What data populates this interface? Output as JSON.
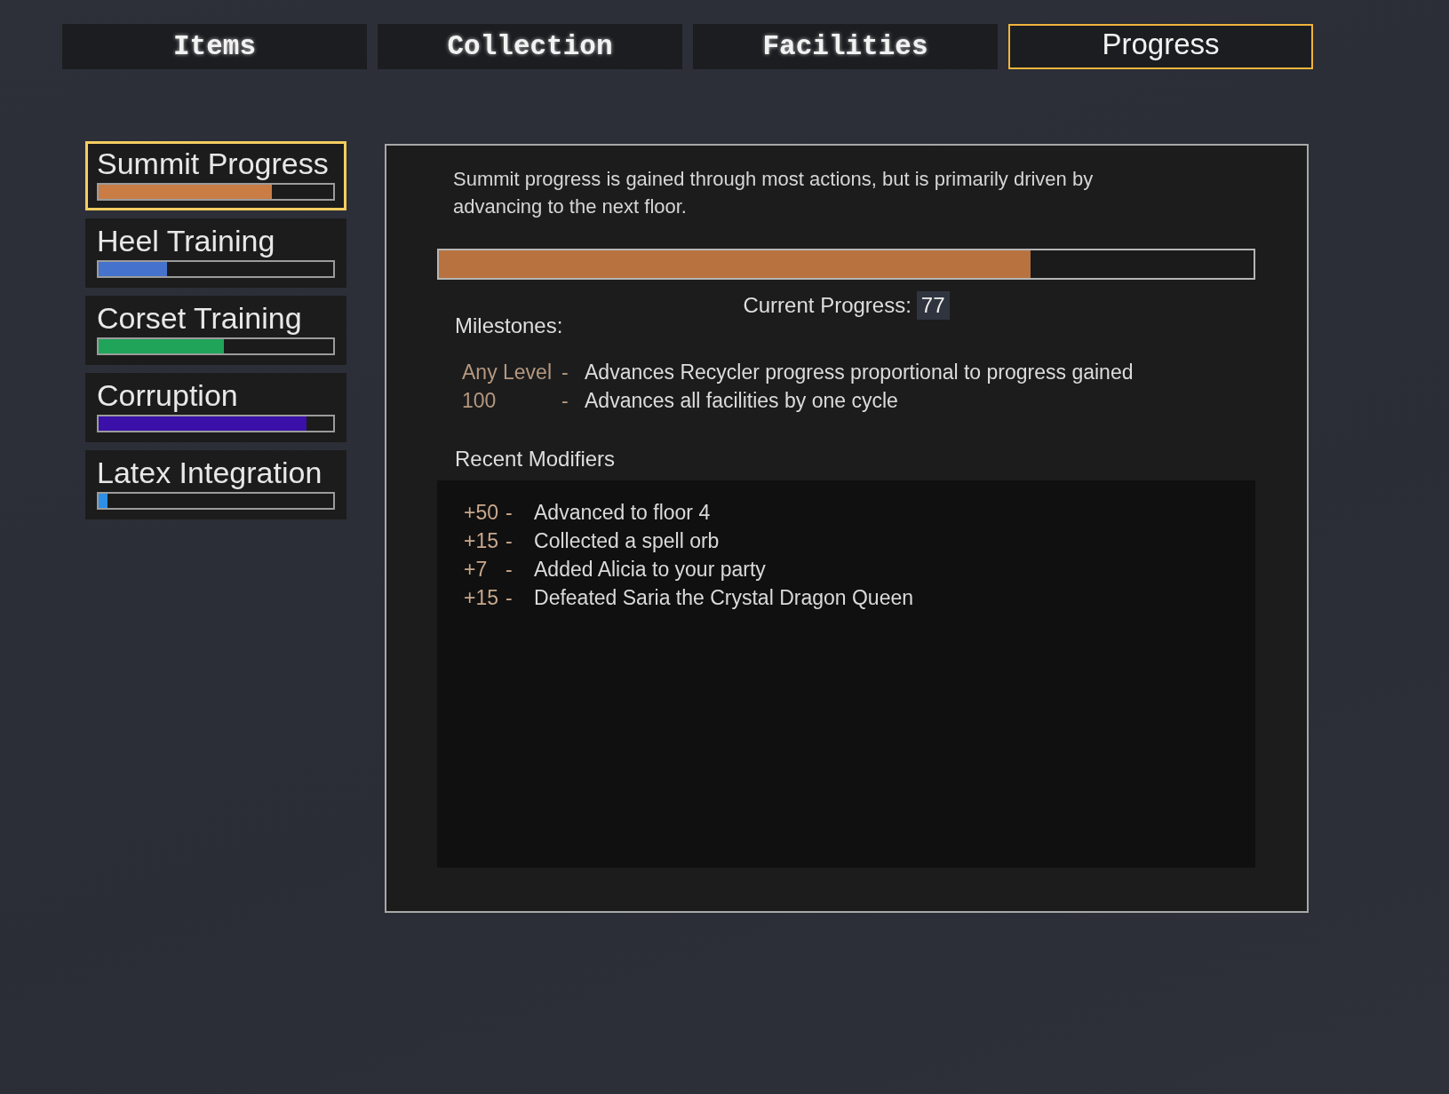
{
  "tabs": [
    {
      "label": "Items",
      "selected": false
    },
    {
      "label": "Collection",
      "selected": false
    },
    {
      "label": "Facilities",
      "selected": false
    },
    {
      "label": "Progress",
      "selected": true
    }
  ],
  "sidebar": {
    "items": [
      {
        "label": "Summit Progress",
        "selected": true,
        "level": 0.74,
        "color": "#c97d45"
      },
      {
        "label": "Heel Training",
        "selected": false,
        "level": 0.29,
        "color": "#4472cc"
      },
      {
        "label": "Corset Training",
        "selected": false,
        "level": 0.535,
        "color": "#1fa45a"
      },
      {
        "label": "Corruption",
        "selected": false,
        "level": 0.886,
        "color": "#3a10a8"
      },
      {
        "label": "Latex Integration",
        "selected": false,
        "level": 0.036,
        "color": "#2d8fe6"
      }
    ]
  },
  "detail": {
    "description": "Summit progress is gained through most actions, but is primarily driven by advancing to the next floor.",
    "progress_bar": {
      "level": 0.726
    },
    "current_progress_label": "Current Progress:",
    "current_progress_value": "77",
    "milestones_title": "Milestones:",
    "milestones": [
      {
        "level": "Any Level",
        "sep": "-",
        "effect": "Advances Recycler progress proportional to progress gained"
      },
      {
        "level": "100",
        "sep": "-",
        "effect": "Advances all facilities by one cycle"
      }
    ],
    "modifiers_title": "Recent Modifiers",
    "modifiers": [
      {
        "amount": "+50",
        "sep": "-",
        "text": "Advanced to floor 4"
      },
      {
        "amount": "+15",
        "sep": "-",
        "text": "Collected a spell orb"
      },
      {
        "amount": "+7",
        "sep": "-",
        "text": "Added Alicia to your party"
      },
      {
        "amount": "+15",
        "sep": "-",
        "text": "Defeated Saria the Crystal Dragon Queen"
      }
    ]
  }
}
